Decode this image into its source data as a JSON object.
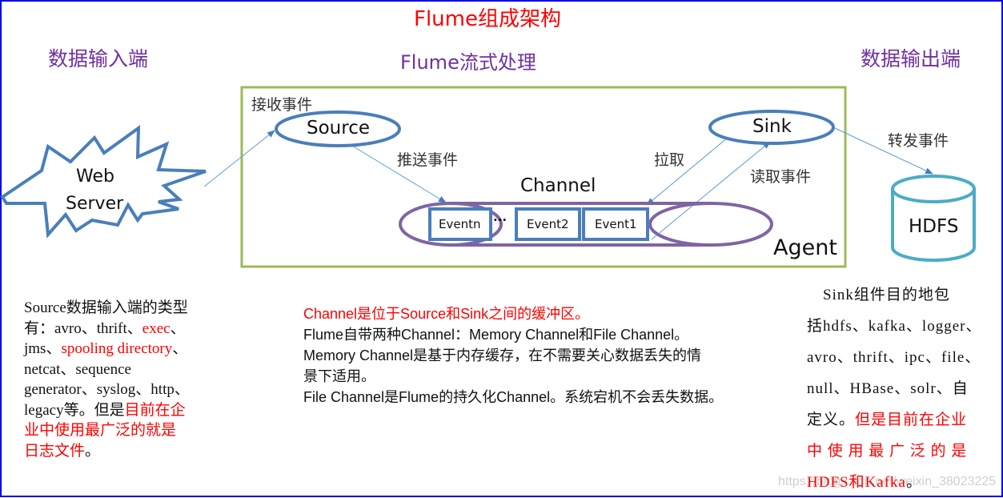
{
  "title": "Flume组成架构",
  "headers": {
    "input": "数据输入端",
    "stream": "Flume流式处理",
    "output": "数据输出端"
  },
  "diagram": {
    "web_server": [
      "Web",
      "Server"
    ],
    "receive_event": "接收事件",
    "source": "Source",
    "push_event": "推送事件",
    "channel": "Channel",
    "events": [
      "Eventn",
      "···",
      "Event2",
      "Event1"
    ],
    "pull": "拉取",
    "read_event": "读取事件",
    "sink": "Sink",
    "forward_event": "转发事件",
    "hdfs": "HDFS",
    "agent": "Agent",
    "colors": {
      "blue": "#4a7ebb",
      "purple": "#8064a2",
      "green": "#9bbb59",
      "cyan": "#4bacc6",
      "arrow": "#5b9bd5"
    }
  },
  "source_desc": {
    "lines": [
      [
        {
          "t": "Source数据输入端的类型",
          "red": false
        }
      ],
      [
        {
          "t": "有：avro、thrift、",
          "red": false
        },
        {
          "t": "exec",
          "red": true
        },
        {
          "t": "、",
          "red": false
        }
      ],
      [
        {
          "t": "jms、",
          "red": false
        },
        {
          "t": "spooling directory",
          "red": true
        },
        {
          "t": "、",
          "red": false
        }
      ],
      [
        {
          "t": "netcat、sequence",
          "red": false
        }
      ],
      [
        {
          "t": "generator、syslog、http、",
          "red": false
        }
      ],
      [
        {
          "t": "legacy等。但是",
          "red": false
        },
        {
          "t": "目前在企",
          "red": true
        }
      ],
      [
        {
          "t": "业中使用最广泛的就是",
          "red": true
        }
      ],
      [
        {
          "t": "日志文件",
          "red": true
        },
        {
          "t": "。",
          "red": false
        }
      ]
    ]
  },
  "channel_desc": {
    "lines": [
      [
        {
          "t": "Channel是位于Source和Sink之间的缓冲区。",
          "red": true
        }
      ],
      [
        {
          "t": "Flume自带两种Channel：Memory Channel和File Channel。",
          "red": false
        }
      ],
      [
        {
          "t": "Memory Channel是基于内存缓存，在不需要关心数据丢失的情",
          "red": false
        }
      ],
      [
        {
          "t": "景下适用。",
          "red": false
        }
      ],
      [
        {
          "t": "File Channel是Flume的持久化Channel。系统宕机不会丢失数据。",
          "red": false
        }
      ]
    ]
  },
  "sink_desc": {
    "lines": [
      [
        {
          "t": "　Sink组件目的地包",
          "red": false
        }
      ],
      [
        {
          "t": "括hdfs、kafka、logger、",
          "red": false
        }
      ],
      [
        {
          "t": "avro、thrift、ipc、file、",
          "red": false
        }
      ],
      [
        {
          "t": "null、HBase、solr、自",
          "red": false
        }
      ],
      [
        {
          "t": "定义。",
          "red": false
        },
        {
          "t": "但是目前在企业",
          "red": true
        }
      ],
      [
        {
          "t": "中 使 用 最 广 泛 的 是",
          "red": true
        }
      ],
      [
        {
          "t": "HDFS和Kafka",
          "red": true
        },
        {
          "t": "。",
          "red": false
        }
      ]
    ]
  },
  "watermark": "https://blog.csdn.net/weixin_38023225"
}
